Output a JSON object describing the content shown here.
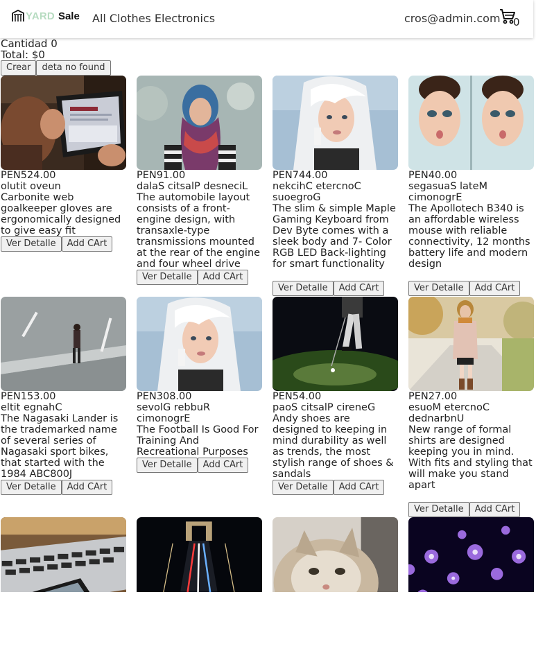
{
  "header": {
    "logo_yard": "YARD",
    "logo_sale": "Sale",
    "nav": [
      "All",
      "Clothes",
      "Electronics"
    ],
    "user_email": "cros@admin.com",
    "cart_count": "0"
  },
  "summary": {
    "cantidad": "Cantidad 0",
    "total": "Total: $0"
  },
  "actions": {
    "crear": "Crear",
    "not_found": "deta no found"
  },
  "card_buttons": {
    "detail": "Ver Detalle",
    "add": "Add CArt"
  },
  "products": [
    {
      "price": "PEN524.00",
      "title": "olutit oveun",
      "description": "Carbonite web goalkeeper gloves are ergonomically designed to give easy fit",
      "image": "tablet-photo"
    },
    {
      "price": "PEN91.00",
      "title": "dalaS citsalP desneciL",
      "description": "The automobile layout consists of a front-engine design, with transaxle-type transmissions mounted at the rear of the engine and four wheel drive",
      "image": "scarf-woman-photo"
    },
    {
      "price": "PEN744.00",
      "title": "nekcihC etercnoC suoegroG",
      "description": "The slim & simple Maple Gaming Keyboard from Dev Byte comes with a sleek body and 7- Color RGB LED Back-lighting for smart functionality",
      "image": "white-hair-woman-photo"
    },
    {
      "price": "PEN40.00",
      "title": "segasuaS lateM cimonogrE",
      "description": "The Apollotech B340 is an affordable wireless mouse with reliable connectivity, 12 months battery life and modern design",
      "image": "twin-faces-photo"
    },
    {
      "price": "PEN153.00",
      "title": "eltit egnahC",
      "description": "The Nagasaki Lander is the trademarked name of several series of Nagasaki sport bikes, that started with the 1984 ABC800J",
      "image": "man-on-road-photo"
    },
    {
      "price": "PEN308.00",
      "title": "sevolG rebbuR cimonogrE",
      "description": "The Football Is Good For Training And Recreational Purposes",
      "image": "white-hair-woman-photo"
    },
    {
      "price": "PEN54.00",
      "title": "paoS citsalP cireneG",
      "description": "Andy shoes are designed to keeping in mind durability as well as trends, the most stylish range of shoes & sandals",
      "image": "golfer-photo"
    },
    {
      "price": "PEN27.00",
      "title": "esuoM etercnoC dednarbnU",
      "description": "New range of formal shirts are designed keeping you in mind. With fits and styling that will make you stand apart",
      "image": "autumn-woman-photo"
    },
    {
      "image": "laptop-phone-photo"
    },
    {
      "image": "bridge-night-photo"
    },
    {
      "image": "cat-photo"
    },
    {
      "image": "fiber-lights-photo"
    }
  ]
}
